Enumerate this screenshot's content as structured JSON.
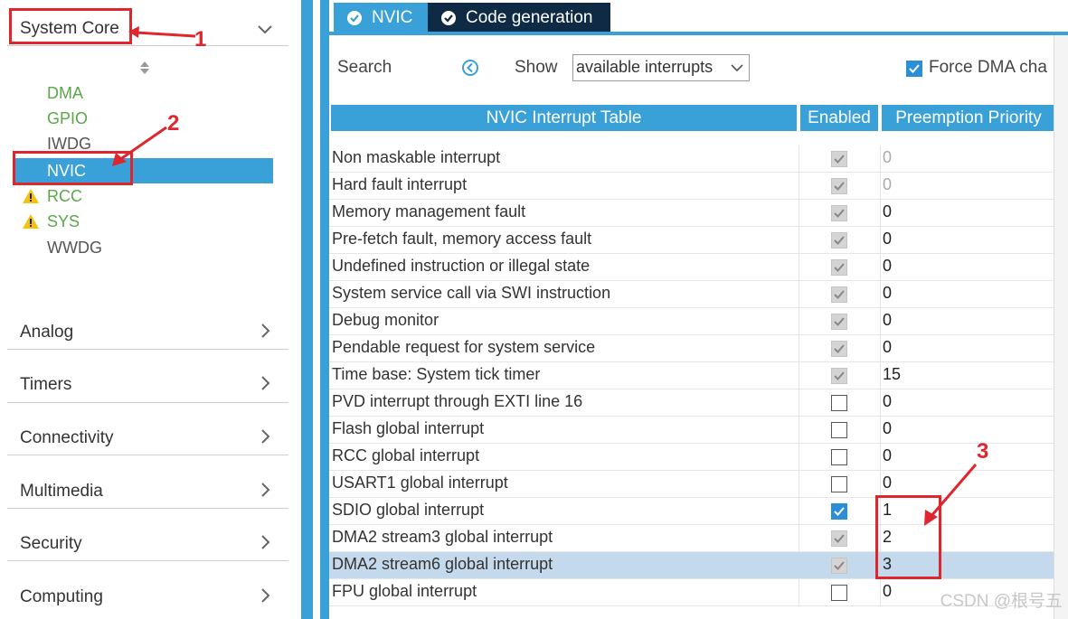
{
  "sidebar": {
    "system_core": "System Core",
    "sub_items": [
      {
        "label": "DMA",
        "status": "ok"
      },
      {
        "label": "GPIO",
        "status": "ok"
      },
      {
        "label": "IWDG",
        "status": "plain"
      },
      {
        "label": "NVIC",
        "status": "selected"
      },
      {
        "label": "RCC",
        "status": "warning"
      },
      {
        "label": "SYS",
        "status": "warning"
      },
      {
        "label": "WWDG",
        "status": "plain"
      }
    ],
    "categories": [
      "Analog",
      "Timers",
      "Connectivity",
      "Multimedia",
      "Security",
      "Computing"
    ]
  },
  "tabs": [
    {
      "label": "NVIC",
      "active": true
    },
    {
      "label": "Code generation",
      "active": false
    }
  ],
  "toolbar": {
    "search_label": "Search",
    "show_label": "Show",
    "show_value": "available interrupts",
    "force_dma_label": "Force DMA cha",
    "force_dma_checked": true
  },
  "table": {
    "headers": [
      "NVIC Interrupt Table",
      "Enabled",
      "Preemption Priority"
    ],
    "rows": [
      {
        "name": "Non maskable interrupt",
        "enabled": "locked",
        "priority": "0",
        "priority_dim": true
      },
      {
        "name": "Hard fault interrupt",
        "enabled": "locked",
        "priority": "0",
        "priority_dim": true
      },
      {
        "name": "Memory management fault",
        "enabled": "locked",
        "priority": "0"
      },
      {
        "name": "Pre-fetch fault, memory access fault",
        "enabled": "locked",
        "priority": "0"
      },
      {
        "name": "Undefined instruction or illegal state",
        "enabled": "locked",
        "priority": "0"
      },
      {
        "name": "System service call via SWI instruction",
        "enabled": "locked",
        "priority": "0"
      },
      {
        "name": "Debug monitor",
        "enabled": "locked",
        "priority": "0"
      },
      {
        "name": "Pendable request for system service",
        "enabled": "locked",
        "priority": "0"
      },
      {
        "name": "Time base: System tick timer",
        "enabled": "locked",
        "priority": "15"
      },
      {
        "name": "PVD interrupt through EXTI line 16",
        "enabled": "off",
        "priority": "0"
      },
      {
        "name": "Flash global interrupt",
        "enabled": "off",
        "priority": "0"
      },
      {
        "name": "RCC global interrupt",
        "enabled": "off",
        "priority": "0"
      },
      {
        "name": "USART1 global interrupt",
        "enabled": "off",
        "priority": "0"
      },
      {
        "name": "SDIO global interrupt",
        "enabled": "on",
        "priority": "1"
      },
      {
        "name": "DMA2 stream3 global interrupt",
        "enabled": "locked",
        "priority": "2"
      },
      {
        "name": "DMA2 stream6 global interrupt",
        "enabled": "locked",
        "priority": "3",
        "selected": true
      },
      {
        "name": "FPU global interrupt",
        "enabled": "off",
        "priority": "0"
      }
    ]
  },
  "annotations": [
    "1",
    "2",
    "3"
  ],
  "watermark": "CSDN @根号五",
  "colors": {
    "accent": "#39a1d8",
    "dark_tab": "#0f2a44",
    "annotation": "#e0262d",
    "ok": "#5aa84a",
    "warning": "#f4c20d",
    "selected_row": "#c5d9ec"
  }
}
